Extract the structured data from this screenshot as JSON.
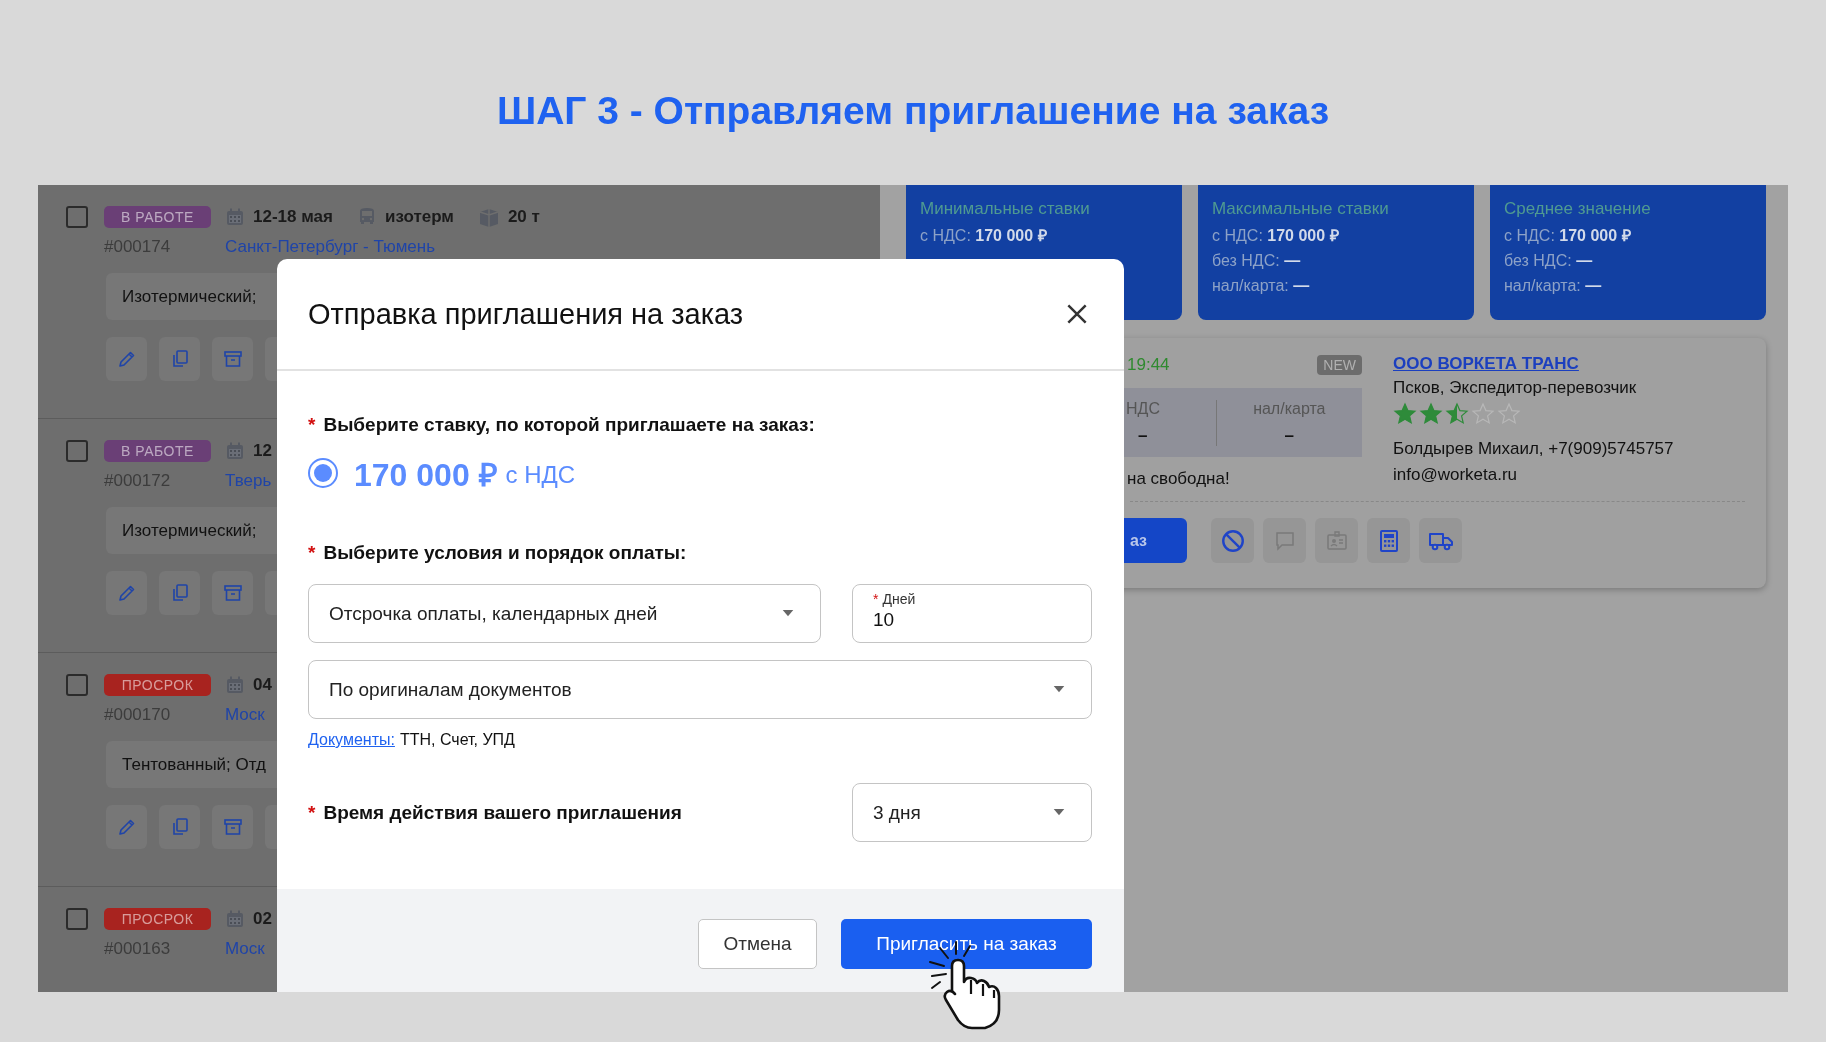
{
  "page_title": "ШАГ 3 - Отправляем приглашение на заказ",
  "orders": [
    {
      "checked": false,
      "status": "В РАБОТЕ",
      "color": "#6a3f76",
      "date": "12-18 мая",
      "body_type": "изотерм",
      "weight": "20 т",
      "number": "#000174",
      "route": "Санкт-Петербург - Тюмень",
      "spec": "Изотермический;"
    },
    {
      "checked": false,
      "status": "В РАБОТЕ",
      "color": "#6a3f76",
      "date": "12",
      "number": "#000172",
      "route": "Тверь",
      "spec": "Изотермический;"
    },
    {
      "checked": false,
      "status": "ПРОСРОК",
      "color": "#a8231f",
      "date": "04",
      "number": "#000170",
      "route": "Моск",
      "spec": "Тентованный; Отд"
    },
    {
      "checked": false,
      "status": "ПРОСРОК",
      "color": "#a8231f",
      "date": "02",
      "number": "#000163",
      "route": "Моск"
    }
  ],
  "stats": [
    {
      "title": "Минимальные ставки",
      "rows": [
        "с НДС: **170 000 ₽**"
      ]
    },
    {
      "title": "Максимальные ставки",
      "rows": [
        "с НДС: **170 000 ₽**",
        "без НДС: **—**",
        "нал/карта: **—**"
      ]
    },
    {
      "title": "Среднее значение",
      "rows": [
        "с НДС: **170 000 ₽**",
        "без НДС: **—**",
        "нал/карта: **—**"
      ]
    }
  ],
  "offer": {
    "time": "19:44",
    "badge": "NEW",
    "prices": [
      {
        "label": "НДС",
        "value": "–"
      },
      {
        "label": "нал/карта",
        "value": "–"
      }
    ],
    "note": "на свободна!",
    "action": "аз",
    "company": {
      "name": "ООО ВОРКЕТА ТРАНС",
      "subtitle": "Псков, Экспедитор-перевозчик",
      "stars": 2.5,
      "contact": "Болдырев Михаил, +7(909)5745757",
      "email": "info@worketa.ru"
    }
  },
  "modal": {
    "title": "Отправка приглашения на заказ",
    "rate_label": {
      "mark": "*",
      "text": "Выберите ставку, по которой приглашаете на заказ:"
    },
    "rate_option": {
      "amount": "170 000 ₽",
      "suffix": "с НДС",
      "selected": true
    },
    "payment_label": {
      "mark": "*",
      "text": "Выберите условия и порядок оплаты:"
    },
    "payment_terms": {
      "value": "Отсрочка оплаты, календарных дней"
    },
    "days": {
      "mark": "*",
      "label": "Дней",
      "value": "10"
    },
    "payment_basis": {
      "value": "По оригиналам документов"
    },
    "documents": {
      "link": "Документы:",
      "text": "ТТН, Счет, УПД"
    },
    "validity_label": {
      "mark": "*",
      "text": "Время действия вашего приглашения"
    },
    "validity": {
      "value": "3 дня"
    },
    "buttons": [
      {
        "label": "Отмена",
        "kind": "secondary"
      },
      {
        "label": "Пригласить на заказ",
        "kind": "primary"
      }
    ]
  }
}
